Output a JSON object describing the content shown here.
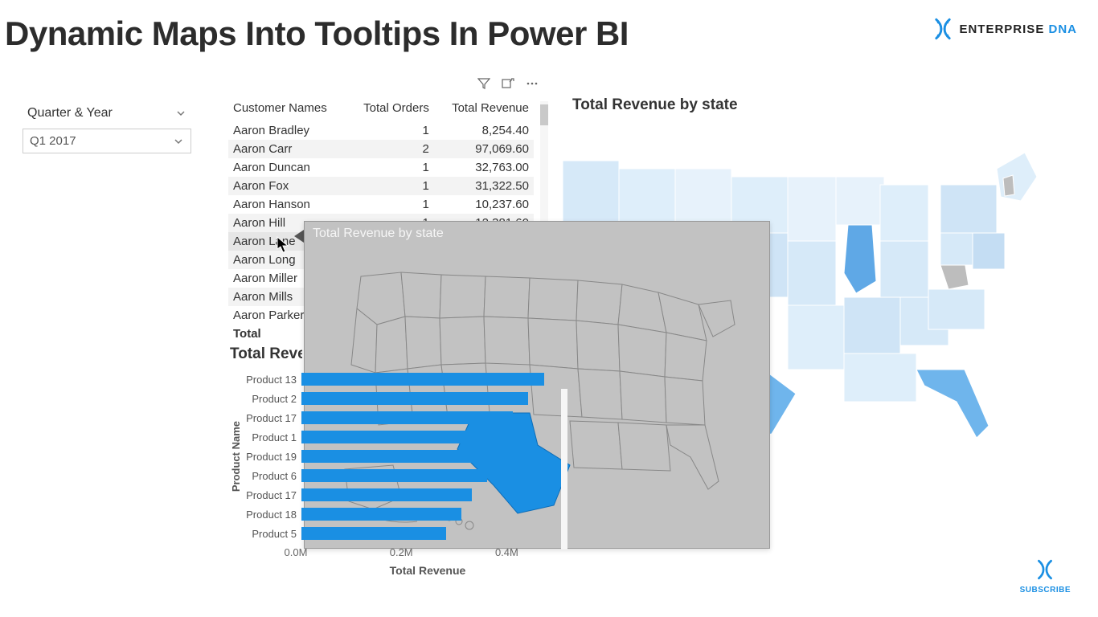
{
  "page": {
    "title": "Dynamic Maps Into Tooltips In Power BI"
  },
  "brand": {
    "name1": "ENTERPRISE",
    "name2": "DNA",
    "subscribe": "SUBSCRIBE"
  },
  "slicer": {
    "label": "Quarter & Year",
    "value": "Q1 2017"
  },
  "table": {
    "headers": {
      "c1": "Customer Names",
      "c2": "Total Orders",
      "c3": "Total Revenue"
    },
    "rows": [
      {
        "name": "Aaron Bradley",
        "orders": "1",
        "rev": "8,254.40",
        "alt": false
      },
      {
        "name": "Aaron Carr",
        "orders": "2",
        "rev": "97,069.60",
        "alt": true
      },
      {
        "name": "Aaron Duncan",
        "orders": "1",
        "rev": "32,763.00",
        "alt": false
      },
      {
        "name": "Aaron Fox",
        "orders": "1",
        "rev": "31,322.50",
        "alt": true
      },
      {
        "name": "Aaron Hanson",
        "orders": "1",
        "rev": "10,237.60",
        "alt": false
      },
      {
        "name": "Aaron Hill",
        "orders": "1",
        "rev": "12,381.60",
        "alt": true
      },
      {
        "name": "Aaron Lane",
        "orders": "",
        "rev": "",
        "alt": false,
        "hover": true
      },
      {
        "name": "Aaron Long",
        "orders": "",
        "rev": "",
        "alt": true
      },
      {
        "name": "Aaron Miller",
        "orders": "",
        "rev": "",
        "alt": false
      },
      {
        "name": "Aaron Mills",
        "orders": "",
        "rev": "",
        "alt": true
      },
      {
        "name": "Aaron Parker",
        "orders": "",
        "rev": "",
        "alt": false
      }
    ],
    "total_label": "Total"
  },
  "map": {
    "title": "Total Revenue by state"
  },
  "tooltip": {
    "title": "Total Revenue by state",
    "highlighted_state": "Texas"
  },
  "chart_data": {
    "type": "bar",
    "title": "Total Revenue",
    "ylabel": "Product Name",
    "xlabel": "Total Revenue",
    "x_ticks": [
      "0.0M",
      "0.2M",
      "0.4M"
    ],
    "xlim": [
      0,
      500000
    ],
    "categories": [
      "Product 13",
      "Product 2",
      "Product 17",
      "Product 1",
      "Product 19",
      "Product 6",
      "Product 17",
      "Product 18",
      "Product 5"
    ],
    "values": [
      470000,
      440000,
      410000,
      400000,
      370000,
      360000,
      330000,
      310000,
      280000
    ]
  }
}
